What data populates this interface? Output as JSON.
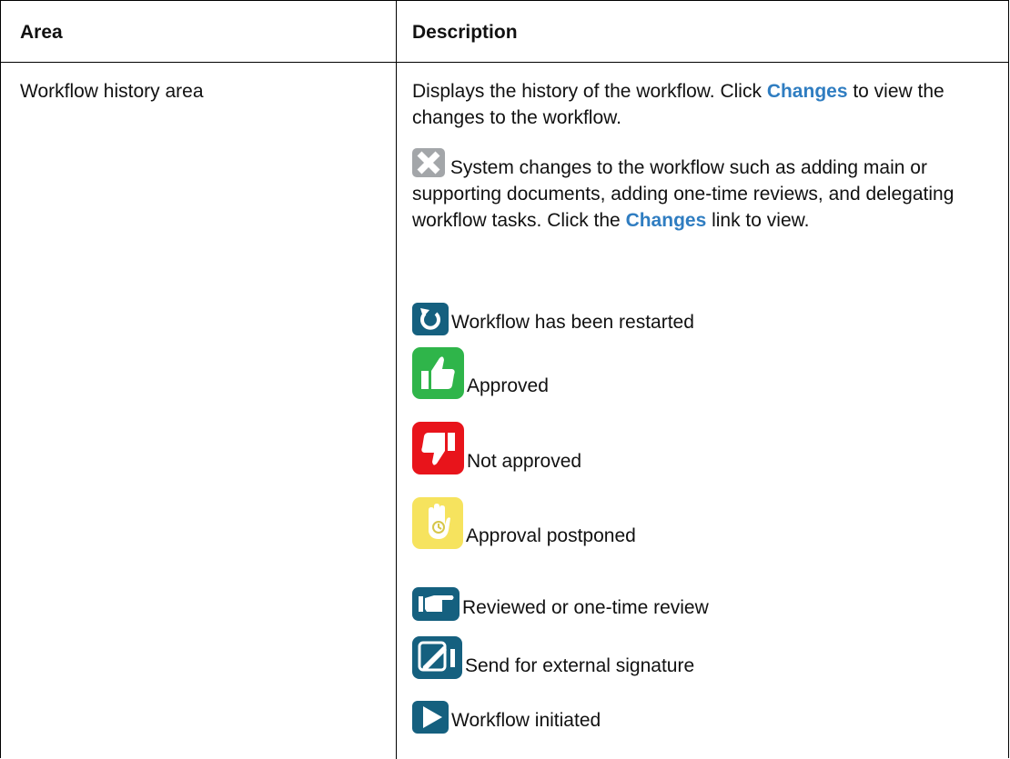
{
  "table": {
    "header_area": "Area",
    "header_description": "Description",
    "area_label": "Workflow history area",
    "para1_before": "Displays the history of the workflow. Click ",
    "para1_link": "Changes",
    "para1_after": " to view the changes to the workflow.",
    "para2_before": " System changes to the workflow such as adding main or supporting documents, adding one-time reviews, and delegating workflow tasks. Click the ",
    "para2_link": "Changes",
    "para2_after": " link to view.",
    "items": [
      {
        "icon": "restart-icon",
        "label": "Workflow has been restarted"
      },
      {
        "icon": "thumbs-up-icon",
        "label": "Approved"
      },
      {
        "icon": "thumbs-down-icon",
        "label": "Not approved"
      },
      {
        "icon": "hand-clock-icon",
        "label": "Approval postponed"
      },
      {
        "icon": "pointing-hand-icon",
        "label": "Reviewed or one-time review"
      },
      {
        "icon": "signature-icon",
        "label": "Send for external signature"
      },
      {
        "icon": "play-icon",
        "label": "Workflow initiated"
      }
    ]
  },
  "colors": {
    "gray_icon": "#a3a6a9",
    "blue_icon": "#15607f",
    "green_icon": "#2fb54a",
    "red_icon": "#e8141b",
    "yellow_icon": "#f6e35e",
    "link": "#2f7dc1"
  }
}
